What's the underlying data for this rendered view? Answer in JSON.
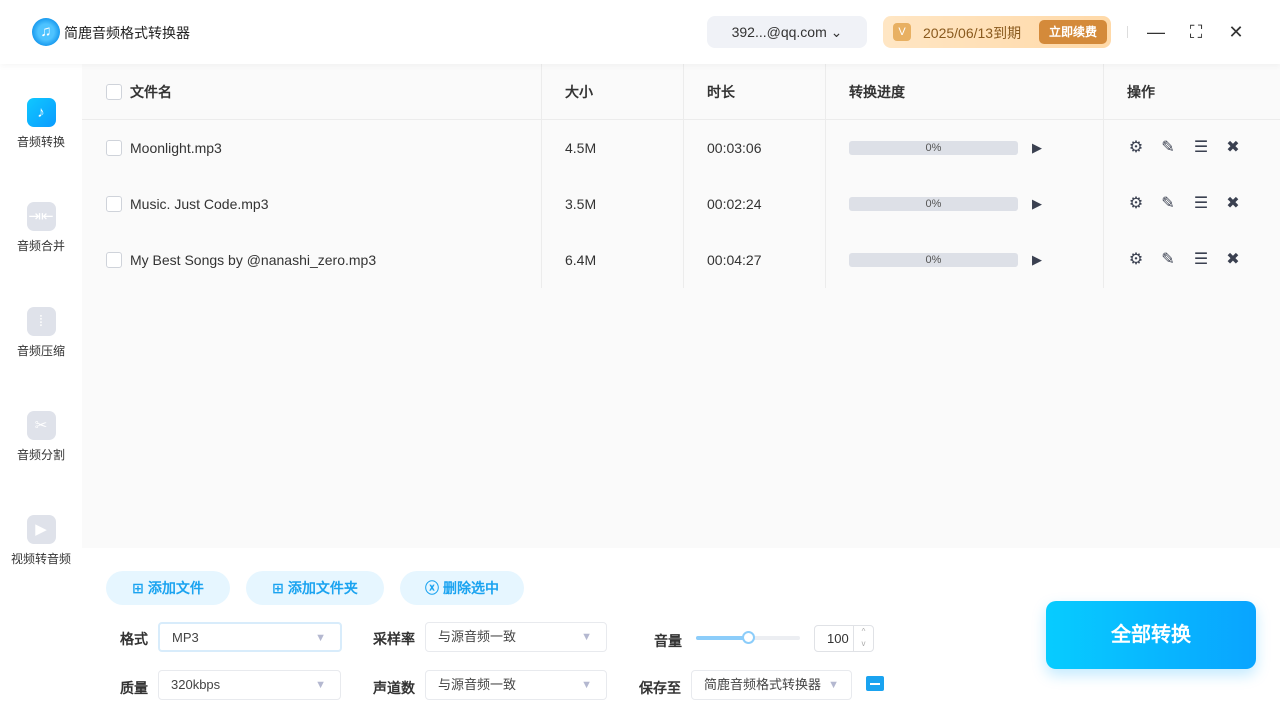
{
  "header": {
    "app_title": "简鹿音频格式转换器",
    "account": "392...@qq.com",
    "expiry": "2025/06/13到期",
    "renew_label": "立即续费"
  },
  "sidebar": {
    "items": [
      {
        "label": "音频转换",
        "active": true
      },
      {
        "label": "音频合并"
      },
      {
        "label": "音频压缩"
      },
      {
        "label": "音频分割"
      },
      {
        "label": "视频转音频"
      }
    ]
  },
  "table": {
    "headers": {
      "name": "文件名",
      "size": "大小",
      "duration": "时长",
      "progress": "转换进度",
      "actions": "操作"
    },
    "rows": [
      {
        "name": "Moonlight.mp3",
        "size": "4.5M",
        "duration": "00:03:06",
        "progress": 0,
        "progress_label": "0%"
      },
      {
        "name": "Music. Just Code.mp3",
        "size": "3.5M",
        "duration": "00:02:24",
        "progress": 0,
        "progress_label": "0%"
      },
      {
        "name": "My Best Songs by @nanashi_zero.mp3",
        "size": "6.4M",
        "duration": "00:04:27",
        "progress": 0,
        "progress_label": "0%"
      }
    ]
  },
  "toolbar": {
    "add_file": "添加文件",
    "add_folder": "添加文件夹",
    "delete_selected": "删除选中"
  },
  "settings": {
    "format_label": "格式",
    "format_value": "MP3",
    "quality_label": "质量",
    "quality_value": "320kbps",
    "sample_rate_label": "采样率",
    "sample_rate_value": "与源音频一致",
    "channels_label": "声道数",
    "channels_value": "与源音频一致",
    "volume_label": "音量",
    "volume_value": "100",
    "volume_slider_fraction": 0.5,
    "save_label": "保存至",
    "save_value": "简鹿音频格式转换器"
  },
  "convert_all": "全部转换",
  "colors": {
    "accent": "#0aa6ff",
    "vip_button": "#d48a3a"
  }
}
